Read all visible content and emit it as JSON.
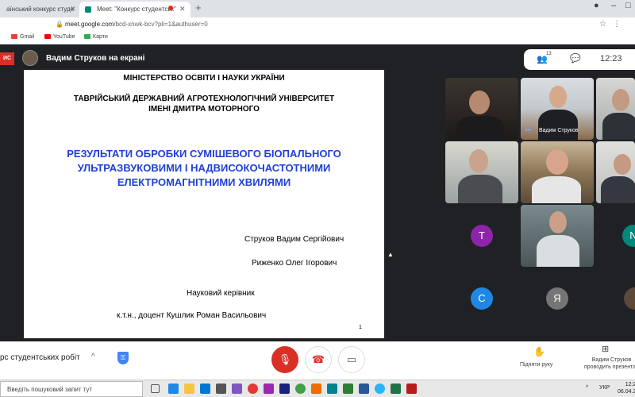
{
  "browser": {
    "tab1_title": "аїнський конкурс студе",
    "tab2_title": "Meet: \"Конкурс студентськ\"",
    "url_domain": "meet.google.com",
    "url_path": "/bcd-xnwk-bcv?pli=1&authuser=0",
    "bookmarks": [
      "Gmail",
      "YouTube",
      "Карти"
    ]
  },
  "meet": {
    "chip": "ИС",
    "presenter_banner": "Вадим Струков на екрані",
    "people_count": "13",
    "clock": "12:23",
    "meeting_name": "рс студентських робіт",
    "raise_hand_label": "Підняти руку",
    "presenting_label_line1": "Вадим Струков",
    "presenting_label_line2": "проводить презентац",
    "tile_name": "Вадим Струков",
    "avatars": [
      "Т",
      "N",
      "С",
      "Я"
    ]
  },
  "slide": {
    "ministry": "МІНІСТЕРСТВО ОСВІТИ І НАУКИ УКРАЇНИ",
    "university_line1": "ТАВРІЙСЬКИЙ ДЕРЖАВНИЙ АГРОТЕХНОЛОГІЧНИЙ УНІВЕРСИТЕТ",
    "university_line2": "ІМЕНІ ДМИТРА МОТОРНОГО",
    "title_line1": "РЕЗУЛЬТАТИ ОБРОБКИ СУМІШЕВОГО БІОПАЛЬНОГО",
    "title_line2": "УЛЬТРАЗВУКОВИМИ І НАДВИСОКОЧАСТОТНИМИ",
    "title_line3": "ЕЛЕКТРОМАГНІТНИМИ ХВИЛЯМИ",
    "author1": "Струков Вадим Сергійович",
    "author2": "Риженко Олег Ігорович",
    "supervisor_label": "Науковий керівник",
    "supervisor": "к.т.н., доцент Кушлик Роман Васильович",
    "page_number": "1"
  },
  "taskbar": {
    "search_placeholder": "Введіть пошуковий запит тут",
    "language": "УКР",
    "time": "12:2",
    "date": "06.04.2"
  },
  "colors": {
    "meet_dark": "#202124",
    "mic_off_red": "#d93025",
    "title_blue": "#1f3fd8"
  }
}
